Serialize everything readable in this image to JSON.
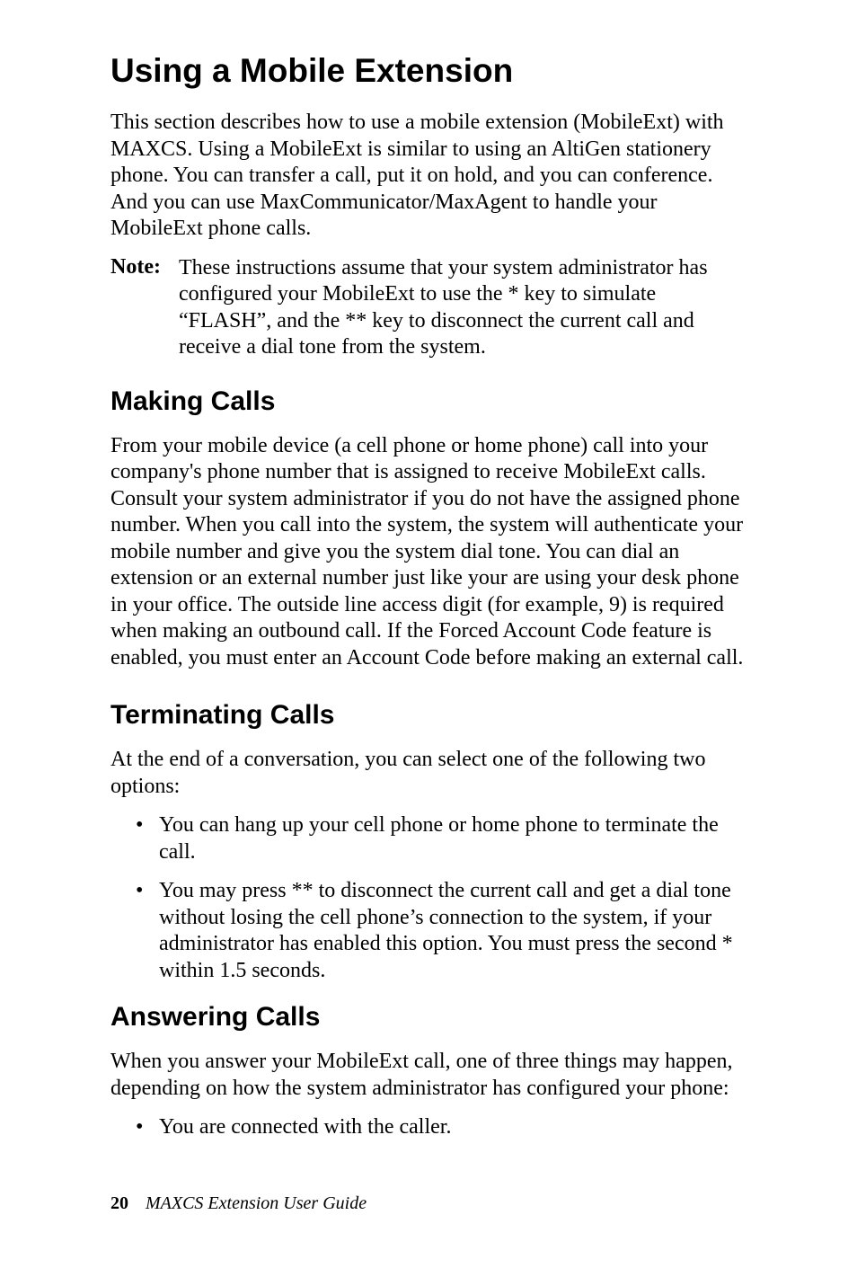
{
  "h1": "Using a Mobile Extension",
  "intro": "This section describes how to use a mobile extension (MobileExt) with MAXCS. Using a MobileExt is similar to using an AltiGen stationery phone. You can transfer a call, put it on hold, and you can conference. And you can use MaxCommunicator/MaxAgent to handle your MobileExt phone calls.",
  "note_label": "Note:",
  "note_text": "These instructions assume that your system administrator has configured your MobileExt to use the * key to simulate “FLASH”, and the ** key to disconnect the current call and receive a dial tone from the system.",
  "making": {
    "title": "Making Calls",
    "body": "From your mobile device (a cell phone or home phone) call into your company's phone number that is assigned to receive MobileExt calls. Consult your system administrator if you do not have the assigned phone number. When you call into the system, the system will authenticate your mobile number and give you the system dial tone. You can dial an extension or an external number just like your are using your desk phone in your office. The outside line access digit (for example, 9) is required when making an outbound call. If the Forced Account Code feature is enabled, you must enter an Account Code before making an external call."
  },
  "terminating": {
    "title": "Terminating Calls",
    "body": "At the end of a conversation, you can select one of the following two options:",
    "items": [
      "You can hang up your cell phone or home phone to terminate the call.",
      "You may  press ** to disconnect the current call and get a dial tone without losing the cell phone’s connection to the system, if your administrator has enabled this option. You must press the second * within 1.5 seconds."
    ]
  },
  "answering": {
    "title": "Answering Calls",
    "body": "When you answer your MobileExt call, one of three things may happen, depending on how the system administrator has configured your phone:",
    "items": [
      "You are connected with the caller."
    ]
  },
  "footer": {
    "page": "20",
    "title": "MAXCS Extension User Guide"
  }
}
